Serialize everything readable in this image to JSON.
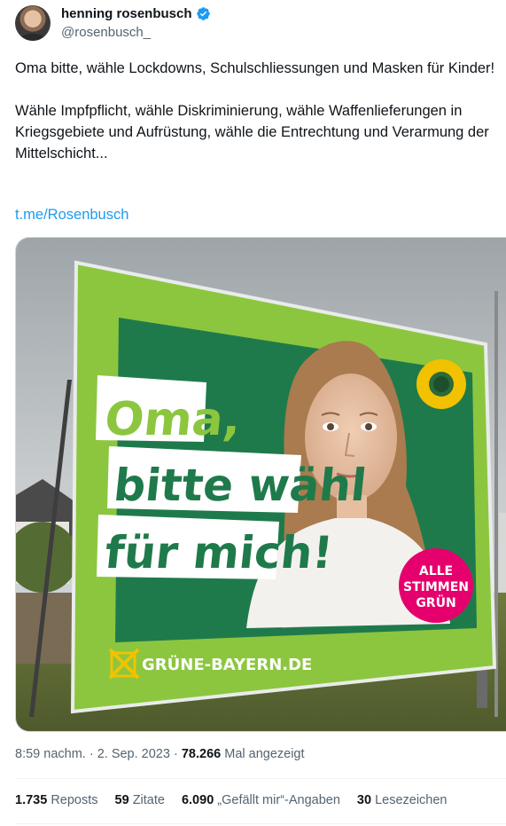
{
  "author": {
    "name": "henning rosenbusch",
    "handle": "@rosenbusch_"
  },
  "tweet": {
    "text": "Oma bitte, wähle Lockdowns, Schulschliessungen und Masken für Kinder!\n\nWähle Impfpflicht, wähle Diskriminierung, wähle Waffenlieferungen in Kriegsgebiete und Aufrüstung, wähle die Entrechtung und Verarmung der Mittelschicht...",
    "link": "t.me/Rosenbusch"
  },
  "poster": {
    "line1": "Oma,",
    "line2": "bitte wähl",
    "line3": "für mich!",
    "badge_line1": "ALLE",
    "badge_line2": "STIMMEN",
    "badge_line3": "GRÜN",
    "footer": "GRÜNE-BAYERN.DE"
  },
  "meta": {
    "time": "8:59 nachm.",
    "date": "2. Sep. 2023",
    "views": "78.266",
    "views_label": "Mal angezeigt"
  },
  "stats": {
    "reposts_count": "1.735",
    "reposts_label": "Reposts",
    "quotes_count": "59",
    "quotes_label": "Zitate",
    "likes_count": "6.090",
    "likes_label": "„Gefällt mir“-Angaben",
    "bookmarks_count": "30",
    "bookmarks_label": "Lesezeichen"
  },
  "colors": {
    "link": "#1d9bf0",
    "poster_green": "#8cc63f",
    "poster_dark_green": "#1e7a4a",
    "badge_pink": "#e5006d",
    "verified_blue": "#1d9bf0"
  }
}
